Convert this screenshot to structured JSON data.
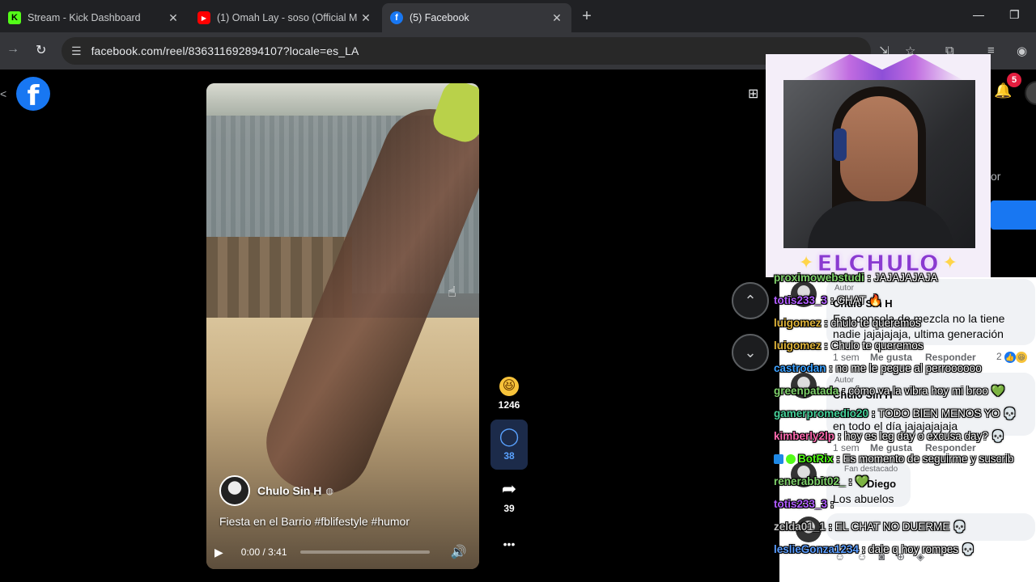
{
  "browser": {
    "tabs": [
      {
        "title": "Stream - Kick Dashboard",
        "favicon": "kick-icon"
      },
      {
        "title": "(1) Omah Lay - soso (Official M",
        "favicon": "youtube-icon"
      },
      {
        "title": "(5) Facebook",
        "favicon": "facebook-icon",
        "active": true
      }
    ],
    "url": "facebook.com/reel/836311692894107?locale=es_LA"
  },
  "facebook": {
    "logo": "f",
    "notification_count": "5",
    "side_text": "or"
  },
  "reel": {
    "owner": "Chulo Sin H",
    "caption": "Fiesta en el Barrio #fblifestyle #humor",
    "time": "0:00 / 3:41",
    "actions": {
      "reactions": "1246",
      "comments": "38",
      "shares": "39"
    }
  },
  "overlay": {
    "banner": "ELCHULO"
  },
  "fb_comments": [
    {
      "badge": "Autor",
      "author": "Chulo Sin H",
      "text": "Esa consola de mezcla no la tiene nadie jajajajaja, ultima generación",
      "age": "1 sem",
      "like": "Me gusta",
      "reply": "Responder",
      "reactions": "2"
    },
    {
      "badge": "Autor",
      "author": "Chulo Sin H",
      "text": "en todo el día jajajajajaja",
      "age": "1 sem",
      "like": "Me gusta",
      "reply": "Responder"
    },
    {
      "badge": "Fan destacado",
      "author": "Diego",
      "text": "Los abuelos"
    }
  ],
  "chat": [
    {
      "user": "proximowebstudi",
      "color": "#7fd16b",
      "message": "JAJAJAJAJA"
    },
    {
      "user": "totis233_3",
      "color": "#b05cff",
      "message": "CHAT 🔥"
    },
    {
      "user": "luigomez",
      "color": "#e0b53a",
      "message": "chulo te queremos"
    },
    {
      "user": "luigomez",
      "color": "#e0b53a",
      "message": "Chulo te queremos"
    },
    {
      "user": "castrodan",
      "color": "#3aa0ff",
      "message": "no me le pegue al perroooooo"
    },
    {
      "user": "greenpatada",
      "color": "#7fd16b",
      "message": "cómo va la vibra hoy mi broo 💚"
    },
    {
      "user": "gamerpromedio20",
      "color": "#46d19a",
      "message": "TODO BIEN MENOS YO 💀"
    },
    {
      "user": "kimberly2lp",
      "color": "#ff6bb0",
      "message": "hoy es leg day o excusa day? 💀"
    },
    {
      "user": "BotRix",
      "color": "#53fc18",
      "message": "Es momento de seguirme y suscrib",
      "bot": true
    },
    {
      "user": "renerabbit02_",
      "color": "#7fd16b",
      "message": "💚"
    },
    {
      "user": "totis233_3",
      "color": "#b05cff",
      "message": ""
    },
    {
      "user": "zelda01_1",
      "color": "#c0c0c0",
      "message": "EL CHAT NO DUERME 💀"
    },
    {
      "user": "leslieGonza1234",
      "color": "#5a9dff",
      "message": "dale q hoy rompes 💀"
    }
  ],
  "icons": {
    "back": "←",
    "forward": "→",
    "reload": "↻",
    "tune": "☰",
    "star": "☆",
    "extensions": "⧉",
    "bell": "🔔",
    "play": "▶",
    "volume": "🔊",
    "more": "•••",
    "up": "⌃",
    "down": "⌄",
    "share": "➦",
    "comment": "◯",
    "haha": "😆"
  },
  "colors": {
    "facebook_blue": "#1877f2",
    "kick_green": "#53fc18",
    "overlay_purple": "#8a3ad0"
  }
}
